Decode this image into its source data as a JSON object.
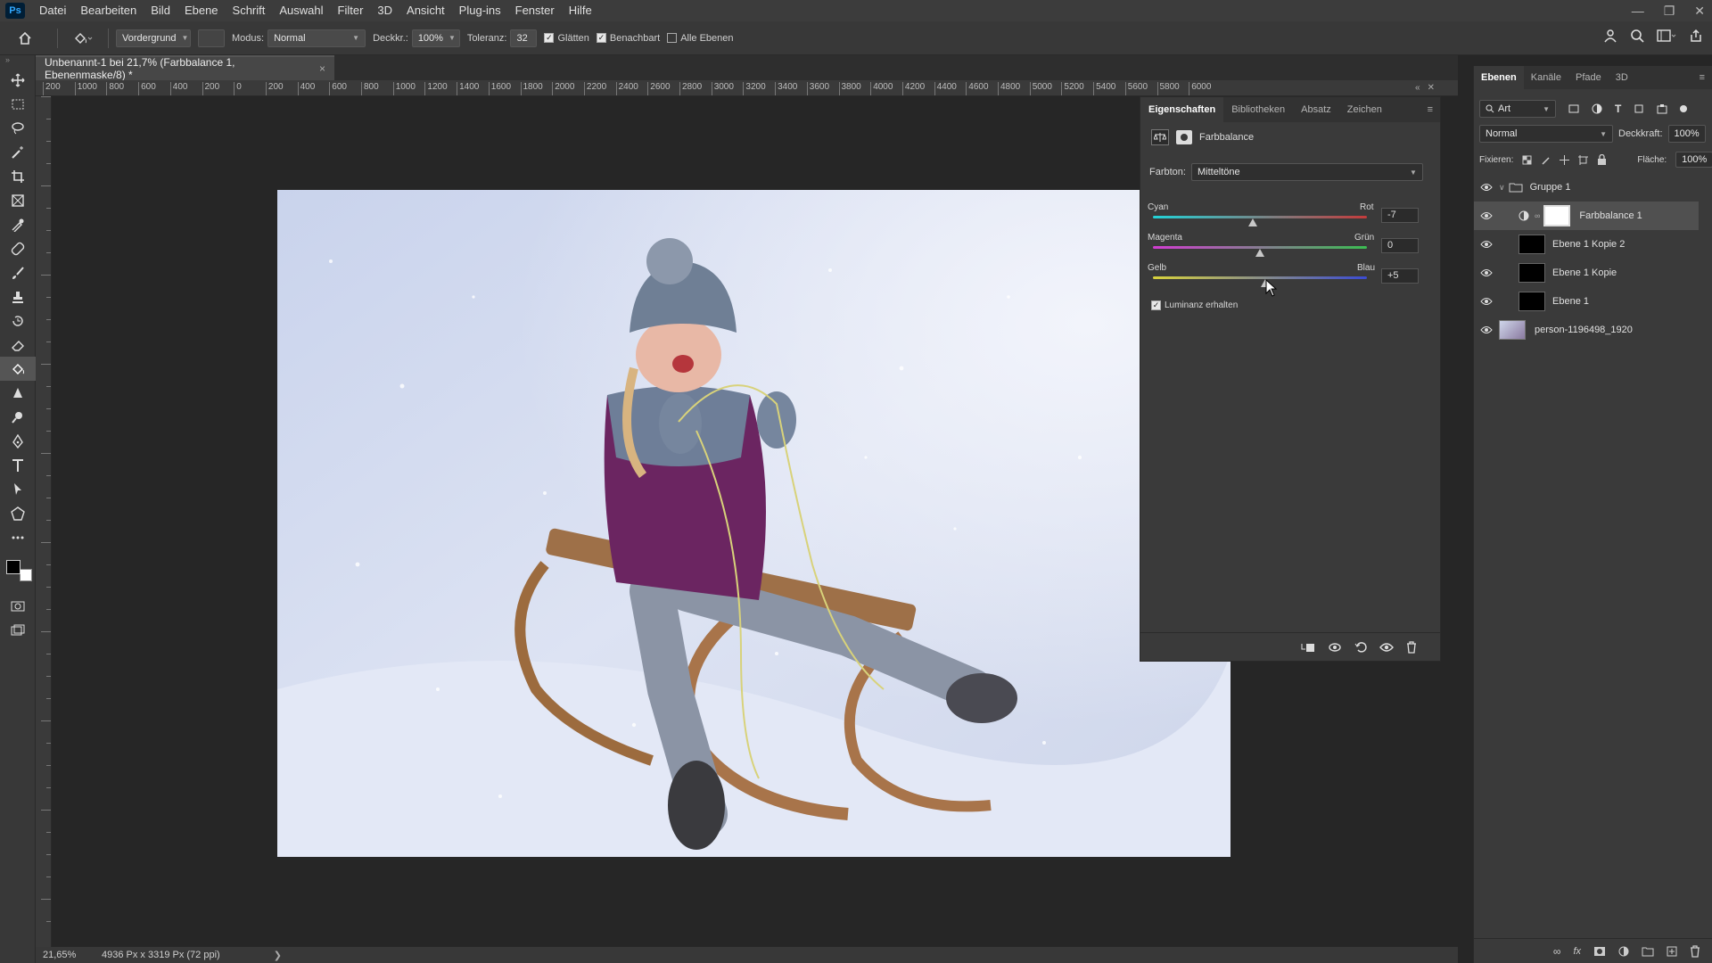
{
  "menubar": {
    "logo": "Ps",
    "items": [
      "Datei",
      "Bearbeiten",
      "Bild",
      "Ebene",
      "Schrift",
      "Auswahl",
      "Filter",
      "3D",
      "Ansicht",
      "Plug-ins",
      "Fenster",
      "Hilfe"
    ]
  },
  "options": {
    "fill_source": "Vordergrund",
    "mode_label": "Modus:",
    "mode_value": "Normal",
    "opacity_label": "Deckkr.:",
    "opacity_value": "100%",
    "tolerance_label": "Toleranz:",
    "tolerance_value": "32",
    "smooth_label": "Glätten",
    "adjacent_label": "Benachbart",
    "all_layers_label": "Alle Ebenen"
  },
  "document": {
    "tab_title": "Unbenannt-1 bei 21,7% (Farbbalance 1, Ebenenmaske/8) *",
    "ruler_h": [
      "200",
      "1000",
      "800",
      "600",
      "400",
      "200",
      "0",
      "200",
      "400",
      "600",
      "800",
      "1000",
      "1200",
      "1400",
      "1600",
      "1800",
      "2000",
      "2200",
      "2400",
      "2600",
      "2800",
      "3000",
      "3200",
      "3400",
      "3600",
      "3800",
      "4000",
      "4200",
      "4400",
      "4600",
      "4800",
      "5000",
      "5200",
      "5400",
      "5600",
      "5800",
      "6000"
    ],
    "zoom": "21,65%",
    "dimensions": "4936 Px x 3319 Px (72 ppi)"
  },
  "properties": {
    "tabs": [
      "Eigenschaften",
      "Bibliotheken",
      "Absatz",
      "Zeichen"
    ],
    "title": "Farbbalance",
    "tone_label": "Farbton:",
    "tone_value": "Mitteltöne",
    "sliders": [
      {
        "left": "Cyan",
        "right": "Rot",
        "value": "-7",
        "level": -7
      },
      {
        "left": "Magenta",
        "right": "Grün",
        "value": "0",
        "level": 0
      },
      {
        "left": "Gelb",
        "right": "Blau",
        "value": "+5",
        "level": 5
      }
    ],
    "preserve_label": "Luminanz erhalten"
  },
  "layers": {
    "tabs": [
      "Ebenen",
      "Kanäle",
      "Pfade",
      "3D"
    ],
    "filter_value": "Art",
    "blend_value": "Normal",
    "opacity_label": "Deckkraft:",
    "opacity_value": "100%",
    "lock_label": "Fixieren:",
    "fill_label": "Fläche:",
    "fill_value": "100%",
    "items": [
      {
        "name": "Gruppe 1"
      },
      {
        "name": "Farbbalance 1"
      },
      {
        "name": "Ebene 1 Kopie 2"
      },
      {
        "name": "Ebene 1 Kopie"
      },
      {
        "name": "Ebene 1"
      },
      {
        "name": "person-1196498_1920"
      }
    ]
  },
  "colors": {
    "accent": "#31a8ff",
    "foreground": "#000000",
    "background": "#ffffff"
  }
}
